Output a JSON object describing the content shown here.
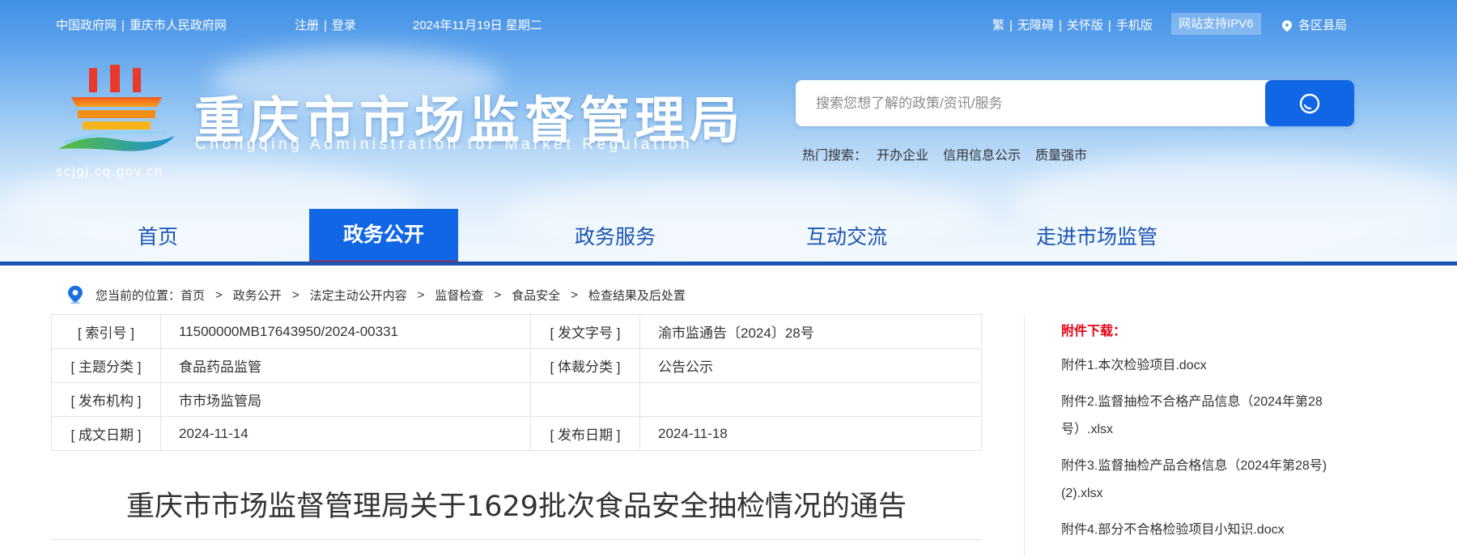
{
  "topbar": {
    "links_left": [
      "中国政府网",
      "重庆市人民政府网"
    ],
    "register": "注册",
    "login": "登录",
    "date": "2024年11月19日 星期二",
    "links_right": [
      "繁",
      "无障碍",
      "关怀版",
      "手机版"
    ],
    "ipv6": "网站支持IPV6",
    "district": "各区县局"
  },
  "header": {
    "title": "重庆市市场监督管理局",
    "subtitle": "Chongqing  Administration for Market Regulation",
    "domain": "scjgj.cq.gov.cn"
  },
  "search": {
    "placeholder": "搜索您想了解的政策/资讯/服务",
    "hot_label": "热门搜索：",
    "hot": [
      "开办企业",
      "信用信息公示",
      "质量强市"
    ]
  },
  "nav": {
    "items": [
      "首页",
      "政务公开",
      "政务服务",
      "互动交流",
      "走进市场监管"
    ],
    "active": "政务公开"
  },
  "breadcrumb": {
    "prefix": "您当前的位置：",
    "items": [
      "首页",
      "政务公开",
      "法定主动公开内容",
      "监督检查",
      "食品安全",
      "检查结果及后处置"
    ],
    "separator": ">"
  },
  "meta": {
    "index_label": "[ 索引号 ]",
    "index_value": "11500000MB17643950/2024-00331",
    "doc_no_label": "[ 发文字号 ]",
    "doc_no_value": "渝市监通告〔2024〕28号",
    "topic_label": "[ 主题分类 ]",
    "topic_value": "食品药品监管",
    "genre_label": "[ 体裁分类 ]",
    "genre_value": "公告公示",
    "issuer_label": "[ 发布机构 ]",
    "issuer_value": "市市场监管局",
    "created_label": "[ 成文日期 ]",
    "created_value": "2024-11-14",
    "published_label": "[ 发布日期 ]",
    "published_value": "2024-11-18"
  },
  "article": {
    "title": "重庆市市场监督管理局关于1629批次食品安全抽检情况的通告"
  },
  "attachments": {
    "heading": "附件下载：",
    "items": [
      "附件1.本次检验项目.docx",
      "附件2.监督抽检不合格产品信息（2024年第28号）.xlsx",
      "附件3.监督抽检产品合格信息（2024年第28号)(2).xlsx",
      "附件4.部分不合格检验项目小知识.docx"
    ]
  },
  "colors": {
    "nav_active": "#1166e6",
    "nav_active_underline": "#d9171b",
    "nav_text": "#1a55b3",
    "attachment_heading": "#e60012"
  }
}
